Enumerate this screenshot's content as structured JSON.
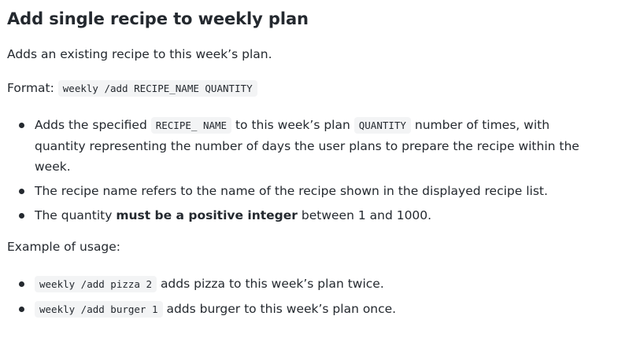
{
  "section": {
    "title": "Add single recipe to weekly plan",
    "description": "Adds an existing recipe to this week’s plan.",
    "format_label": "Format:",
    "format_code": "weekly /add RECIPE_NAME QUANTITY"
  },
  "bullets": {
    "b1": {
      "text_a": "Adds the specified",
      "code_a": "RECIPE_ NAME",
      "text_b": "to this week’s plan",
      "code_b": "QUANTITY",
      "text_c": "number of times, with",
      "line2": "quantity representing the number of days the user plans to prepare the recipe within the",
      "line3": "week."
    },
    "b2": {
      "text": "The recipe name refers to the name of the recipe shown in the displayed recipe list."
    },
    "b3": {
      "text_a": "The quantity",
      "strong": "must be a positive integer",
      "text_b": "between 1 and 1000."
    }
  },
  "example": {
    "label": "Example of usage:",
    "items": [
      {
        "code": "weekly /add pizza 2",
        "text": "adds pizza to this week’s plan twice."
      },
      {
        "code": "weekly /add burger 1",
        "text": "adds burger to this week’s plan once."
      }
    ]
  }
}
